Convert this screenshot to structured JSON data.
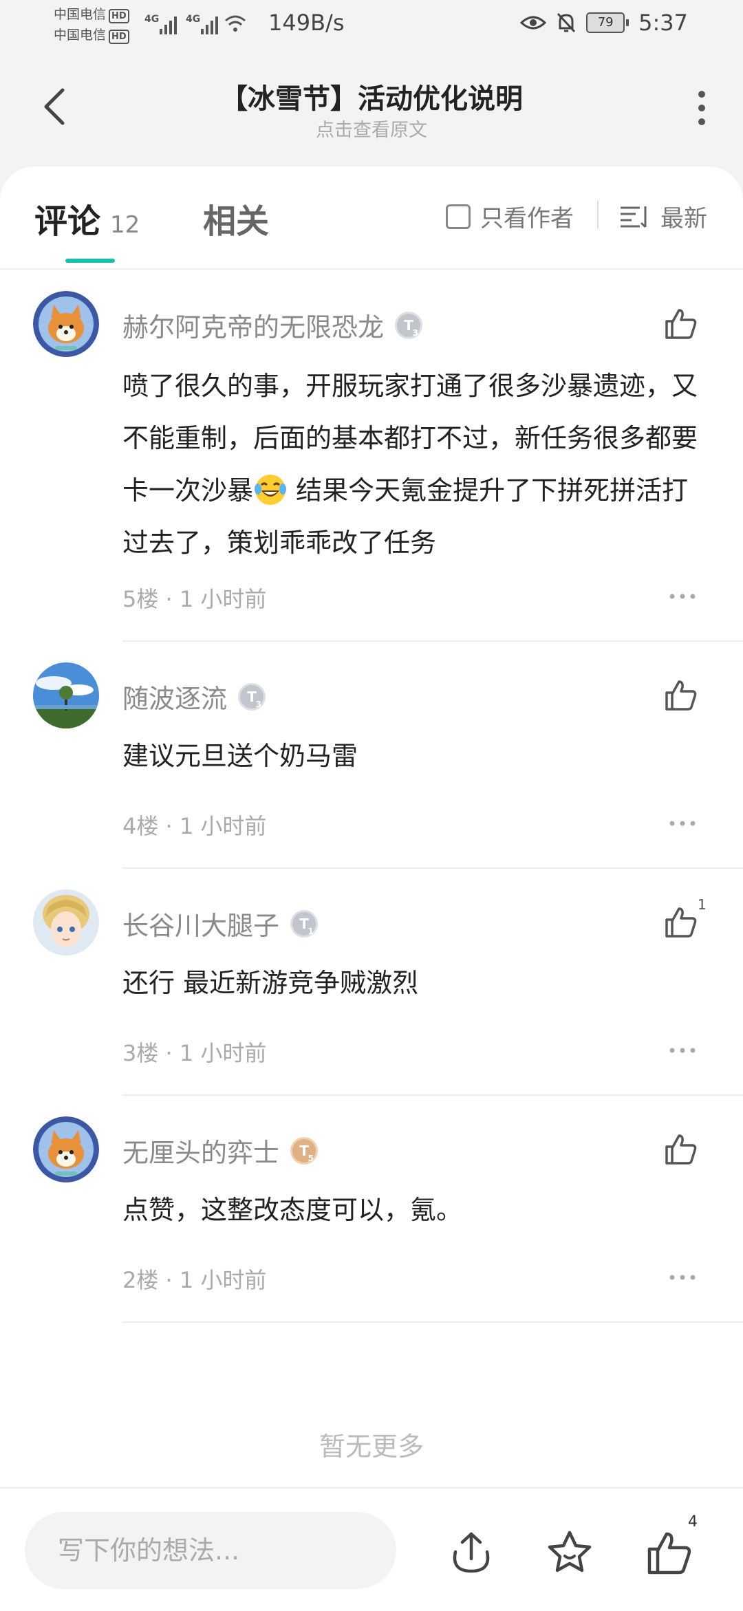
{
  "status_bar": {
    "carrier1": "中国电信",
    "carrier2": "中国电信",
    "hd": "HD",
    "net": "4G",
    "net_speed": "149B/s",
    "battery": "79",
    "time": "5:37"
  },
  "header": {
    "title": "【冰雪节】活动优化说明",
    "subtitle": "点击查看原文"
  },
  "tabs": {
    "comments_label": "评论",
    "comments_count": "12",
    "related_label": "相关",
    "author_only_label": "只看作者",
    "sort_label": "最新"
  },
  "comments": [
    {
      "name": "赫尔阿克帝的无限恐龙",
      "level": "T",
      "level_num": "3",
      "level_color": "silver",
      "text_before_emoji": "喷了很久的事，开服玩家打通了很多沙暴遗迹，又不能重制，后面的基本都打不过，新任务很多都要卡一次沙暴",
      "emoji": "laughing-tears",
      "text_after_emoji": " 结果今天氪金提升了下拼死拼活打过去了，策划乖乖改了任务",
      "meta": "5楼 · 1 小时前",
      "likes": ""
    },
    {
      "name": "随波逐流",
      "level": "T",
      "level_num": "3",
      "level_color": "silver",
      "text": "建议元旦送个奶马雷",
      "meta": "4楼 · 1 小时前",
      "likes": ""
    },
    {
      "name": "长谷川大腿子",
      "level": "T",
      "level_num": "1",
      "level_color": "silver",
      "text": "还行 最近新游竞争贼激烈",
      "meta": "3楼 · 1 小时前",
      "likes": "1"
    },
    {
      "name": "无厘头的弈士",
      "level": "T",
      "level_num": "5",
      "level_color": "bronze",
      "text": "点赞，这整改态度可以，氪。",
      "meta": "2楼 · 1 小时前",
      "likes": ""
    }
  ],
  "end_text": "暂无更多",
  "bottom_bar": {
    "input_placeholder": "写下你的想法...",
    "like_count": "4"
  },
  "colors": {
    "accent": "#14c1a8",
    "background": "#f2f3f5"
  }
}
